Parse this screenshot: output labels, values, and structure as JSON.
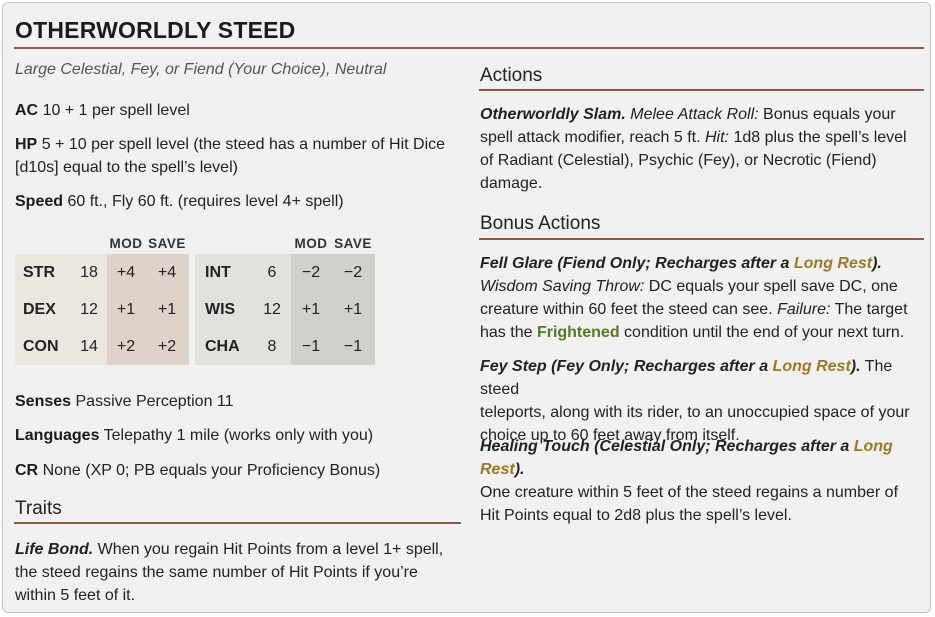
{
  "statblock": {
    "title": "OTHERWORLDLY STEED",
    "subtitle": "Large Celestial, Fey, or Fiend (Your Choice), Neutral",
    "ac_label": "AC",
    "ac_value": "10 + 1 per spell level",
    "hp_label": "HP",
    "hp_value_1": "5 + 10 per spell level (the steed has a number of Hit Dice",
    "hp_value_2": "[d10s] equal to the spell’s level)",
    "speed_label": "Speed",
    "speed_value": "60 ft., Fly 60 ft. (requires level 4+ spell)",
    "abilities_header": {
      "mod": "MOD",
      "save": "SAVE"
    },
    "physical": [
      {
        "name": "STR",
        "score": "18",
        "mod": "+4",
        "save": "+4"
      },
      {
        "name": "DEX",
        "score": "12",
        "mod": "+1",
        "save": "+1"
      },
      {
        "name": "CON",
        "score": "14",
        "mod": "+2",
        "save": "+2"
      }
    ],
    "mental": [
      {
        "name": "INT",
        "score": "6",
        "mod": "−2",
        "save": "−2"
      },
      {
        "name": "WIS",
        "score": "12",
        "mod": "+1",
        "save": "+1"
      },
      {
        "name": "CHA",
        "score": "8",
        "mod": "−1",
        "save": "−1"
      }
    ],
    "senses_label": "Senses",
    "senses_value": "Passive Perception 11",
    "languages_label": "Languages",
    "languages_value": "Telepathy 1 mile (works only with you)",
    "cr_label": "CR",
    "cr_value": "None (XP 0; PB equals your Proficiency Bonus)",
    "traits_heading": "Traits",
    "trait_name": "Life Bond.",
    "trait_text_1": " When you regain Hit Points from a level 1+ spell,",
    "trait_text_2": "the steed regains the same number of Hit Points if you’re",
    "trait_text_3": "within 5 feet of it.",
    "actions_heading": "Actions",
    "slam_name": "Otherworldly Slam.",
    "slam_type": "Melee Attack Roll:",
    "slam_text_1": " Bonus equals your",
    "slam_text_2a": "spell attack modifier, reach 5 ft. ",
    "slam_hit": "Hit:",
    "slam_text_2b": " 1d8 plus the spell’s level",
    "slam_text_3": "of Radiant (Celestial), Psychic (Fey), or Necrotic (Fiend)",
    "slam_text_4": "damage.",
    "bonus_heading": "Bonus Actions",
    "glare_name": "Fell Glare (Fiend Only; Recharges after a ",
    "long_rest": "Long Rest",
    "close_paren_dot": ").",
    "glare_save": "Wisdom Saving Throw:",
    "glare_text_1": " DC equals your spell save DC, one",
    "glare_text_2": "creature within 60 feet the steed can see. ",
    "failure": "Failure:",
    "glare_text_3": " The target",
    "glare_text_4a": "has the ",
    "frightened": "Frightened",
    "glare_text_4b": " condition until the end of your next turn.",
    "fey_name": "Fey Step (Fey Only; Recharges after a ",
    "fey_text_1": " The steed",
    "fey_text_2": "teleports, along with its rider, to an unoccupied space of your",
    "fey_text_3": "choice up to 60 feet away from itself.",
    "heal_name": "Healing Touch (Celestial Only; Recharges after a ",
    "heal_text_1": "One creature within 5 feet of the steed regains a number of",
    "heal_text_2": "Hit Points equal to 2d8 plus the spell’s level."
  },
  "colors": {
    "rule": "#8c5a50",
    "long_rest_link": "#9a7a2c",
    "condition_link": "#577a2a"
  }
}
